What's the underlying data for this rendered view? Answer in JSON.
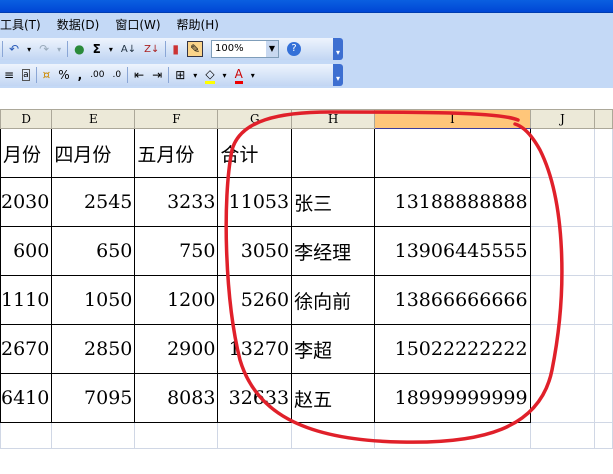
{
  "menu": [
    "工具(T)",
    "数据(D)",
    "窗口(W)",
    "帮助(H)"
  ],
  "toolbar1": {
    "undo": "↶",
    "redo": "↷",
    "sum": "Σ",
    "sort_asc": "A↓",
    "sort_desc": "Z↓",
    "zoom": "100%",
    "help": "?"
  },
  "toolbar2": {
    "percent": "%",
    "comma": ",",
    "inc_decimal": ".00",
    "dec_decimal": ".0",
    "font_color": "A"
  },
  "columns": [
    "D",
    "E",
    "F",
    "G",
    "H",
    "I",
    "J"
  ],
  "rows": [
    [
      "月份",
      "四月份",
      "五月份",
      "合计",
      "",
      ""
    ],
    [
      "2030",
      "2545",
      "3233",
      "11053",
      "张三",
      "13188888888"
    ],
    [
      "600",
      "650",
      "750",
      "3050",
      "李经理",
      "13906445555"
    ],
    [
      "1110",
      "1050",
      "1200",
      "5260",
      "徐向前",
      "13866666666"
    ],
    [
      "2670",
      "2850",
      "2900",
      "13270",
      "李超",
      "15022222222"
    ],
    [
      "6410",
      "7095",
      "8083",
      "32633",
      "赵五",
      "18999999999"
    ]
  ],
  "colors": {
    "annotation": "#e0202a",
    "selected_header": "#ffc67a"
  }
}
